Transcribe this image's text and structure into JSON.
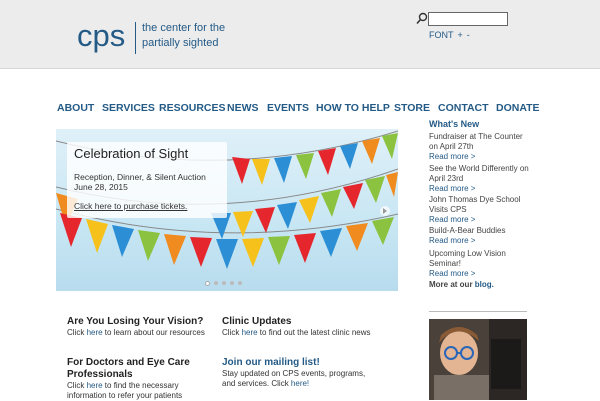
{
  "header": {
    "logo": "cps",
    "tagline_line1": "the center for the",
    "tagline_line2": "partially sighted",
    "search_placeholder": "",
    "font_label": "FONT",
    "font_plus": "+",
    "font_minus": "-"
  },
  "nav": {
    "items": [
      {
        "label": "ABOUT"
      },
      {
        "label": "SERVICES"
      },
      {
        "label": "RESOURCES"
      },
      {
        "label": "NEWS"
      },
      {
        "label": "EVENTS"
      },
      {
        "label": "HOW TO HELP"
      },
      {
        "label": "STORE"
      },
      {
        "label": "CONTACT"
      },
      {
        "label": "DONATE"
      }
    ]
  },
  "slider": {
    "title": "Celebration of Sight",
    "subtitle1": "Reception, Dinner, & Silent Auction",
    "subtitle2": "June 28, 2015",
    "link": "Click here to purchase tickets."
  },
  "sidebar": {
    "title": "What's New",
    "items": [
      {
        "line1": "Fundraiser at The Counter",
        "line2": "on April 27th",
        "more": "Read more >"
      },
      {
        "line1": "See the World Differently on",
        "line2": "April 23rd",
        "more": "Read more >"
      },
      {
        "line1": "John Thomas Dye School",
        "line2": "Visits CPS",
        "more": "Read more >"
      },
      {
        "line1": "Build-A-Bear Buddies",
        "line2": "",
        "more": "Read more >"
      },
      {
        "line1": "Upcoming Low Vision",
        "line2": "Seminar!",
        "more": "Read more >"
      }
    ],
    "more_prefix": "More at our ",
    "more_link": "blog."
  },
  "blocks": {
    "vision": {
      "title": "Are You Losing Your Vision?",
      "pre": "Click ",
      "link": "here",
      "post": " to learn about our resources"
    },
    "clinic": {
      "title": "Clinic Updates",
      "pre": "Click ",
      "link": "here",
      "post": " to find out the latest clinic news"
    },
    "doctors": {
      "title1": "For Doctors and Eye Care",
      "title2": "Professionals",
      "pre": "Click ",
      "link": "here",
      "post1": " to find the necessary",
      "line3": "information to refer your patients"
    },
    "mailing": {
      "title": "Join our mailing list!",
      "line1": "Stay updated on CPS events, programs,",
      "line2pre": "and services. Click ",
      "link": "here!"
    }
  },
  "colors": {
    "brand": "#245a86",
    "header_bg": "#ececec"
  }
}
